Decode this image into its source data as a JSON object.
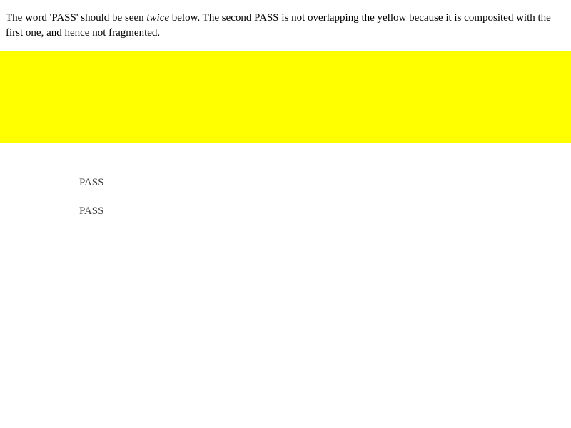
{
  "intro": {
    "part1": "The word 'PASS' should be seen ",
    "emphasis": "twice",
    "part2": " below. The second PASS is not overlapping the yellow because it is composited with the first one, and hence not fragmented."
  },
  "band": {
    "color": "#ffff00"
  },
  "pass_items": [
    {
      "label": "PASS"
    },
    {
      "label": "PASS"
    }
  ],
  "colors": {
    "background": "#ffffff",
    "text": "#000000",
    "pass_text": "#3c3c3c"
  }
}
